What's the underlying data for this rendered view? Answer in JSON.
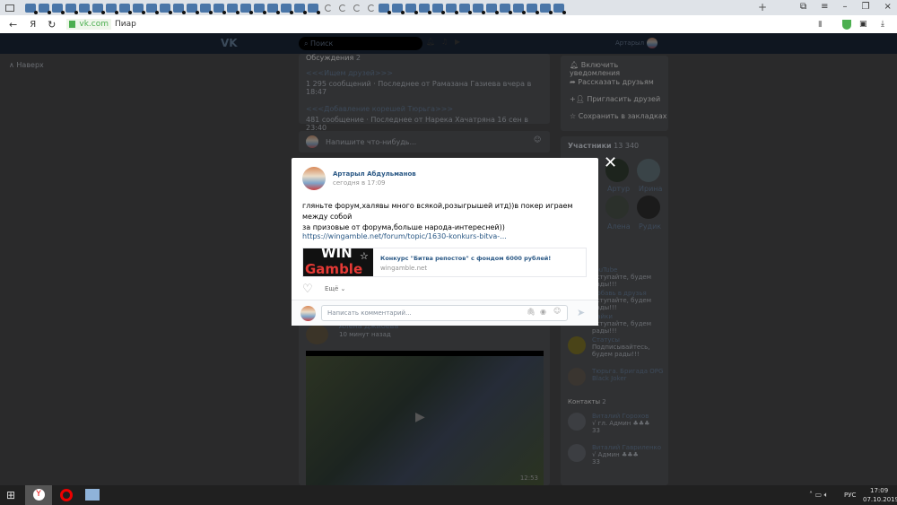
{
  "browser": {
    "url_domain": "vk.com",
    "page_title": "Пиар",
    "tab_count_visible": 40
  },
  "vk_header": {
    "search_placeholder": "Поиск",
    "user_name": "Артарыл"
  },
  "left_nav": {
    "scroll_up": "Наверх"
  },
  "discussions": {
    "title": "Обсуждения",
    "count": "2",
    "topics": [
      {
        "title": "<<<Ищем друзей>>>",
        "meta": "1 295 сообщений  ·  Последнее от Рамазана Газиева вчера в 18:47"
      },
      {
        "title": "<<<Добавление корешей Тюрьга>>>",
        "meta": "481 сообщение  ·  Последнее от Нарека Хачатряна 16 сен в 23:40"
      }
    ]
  },
  "composer": {
    "placeholder": "Напишите что-нибудь..."
  },
  "bg_post": {
    "author": "Алена Джиоева",
    "time": "10 минут назад",
    "video_duration": "12:53"
  },
  "actions": [
    "Включить уведомления",
    "Рассказать друзьям",
    "Пригласить друзей",
    "Сохранить в закладках"
  ],
  "members": {
    "title": "Участники",
    "count": "13 340",
    "names": [
      "Артур",
      "Ирина",
      "Алена",
      "Рудик"
    ]
  },
  "groups": [
    {
      "name": "YouTube",
      "desc": "Вступайте, будем рады!!!"
    },
    {
      "name": "Добавь в друзья",
      "desc": "Вступайте, будем рады!!!"
    },
    {
      "name": "Лайки",
      "desc": "Вступайте, будем рады!!!"
    },
    {
      "name": "Статусы",
      "desc": "Подписывайтесь, будем рады!!!"
    },
    {
      "name": "Тюрьга. Бригада OPG Black Joker",
      "desc": ""
    }
  ],
  "contacts": {
    "title": "Контакты",
    "count": "2",
    "items": [
      {
        "name": "Виталий Горохов",
        "role": "√ гл. Админ ♣♣♣",
        "extra": "33"
      },
      {
        "name": "Виталий Гавриленко",
        "role": "√ Админ ♣♣♣",
        "extra": "33"
      }
    ]
  },
  "modal": {
    "author": "Артарыл Абдульманов",
    "time": "сегодня в 17:09",
    "text1": "гляньте форум,халявы много всякой,розыгрышей итд))в покер играем между собой",
    "text2": "за призовые от форума,больше народа-интересней))",
    "link": "https://wingamble.net/forum/topic/1630-konkurs-bitva-...",
    "snippet_title": "Конкурс \"Битва репостов\" с фондом 6000 рублей!",
    "snippet_domain": "wingamble.net",
    "logo_text_1": "WIN",
    "logo_text_2": "Gamble",
    "more": "Ещё",
    "comment_placeholder": "Написать комментарий..."
  },
  "taskbar": {
    "lang": "РУС",
    "time": "17:09",
    "date": "07.10.2019"
  },
  "colors": {
    "vk_blue": "#2a5885",
    "link": "#2a5885",
    "accent": "#4a76a8"
  }
}
